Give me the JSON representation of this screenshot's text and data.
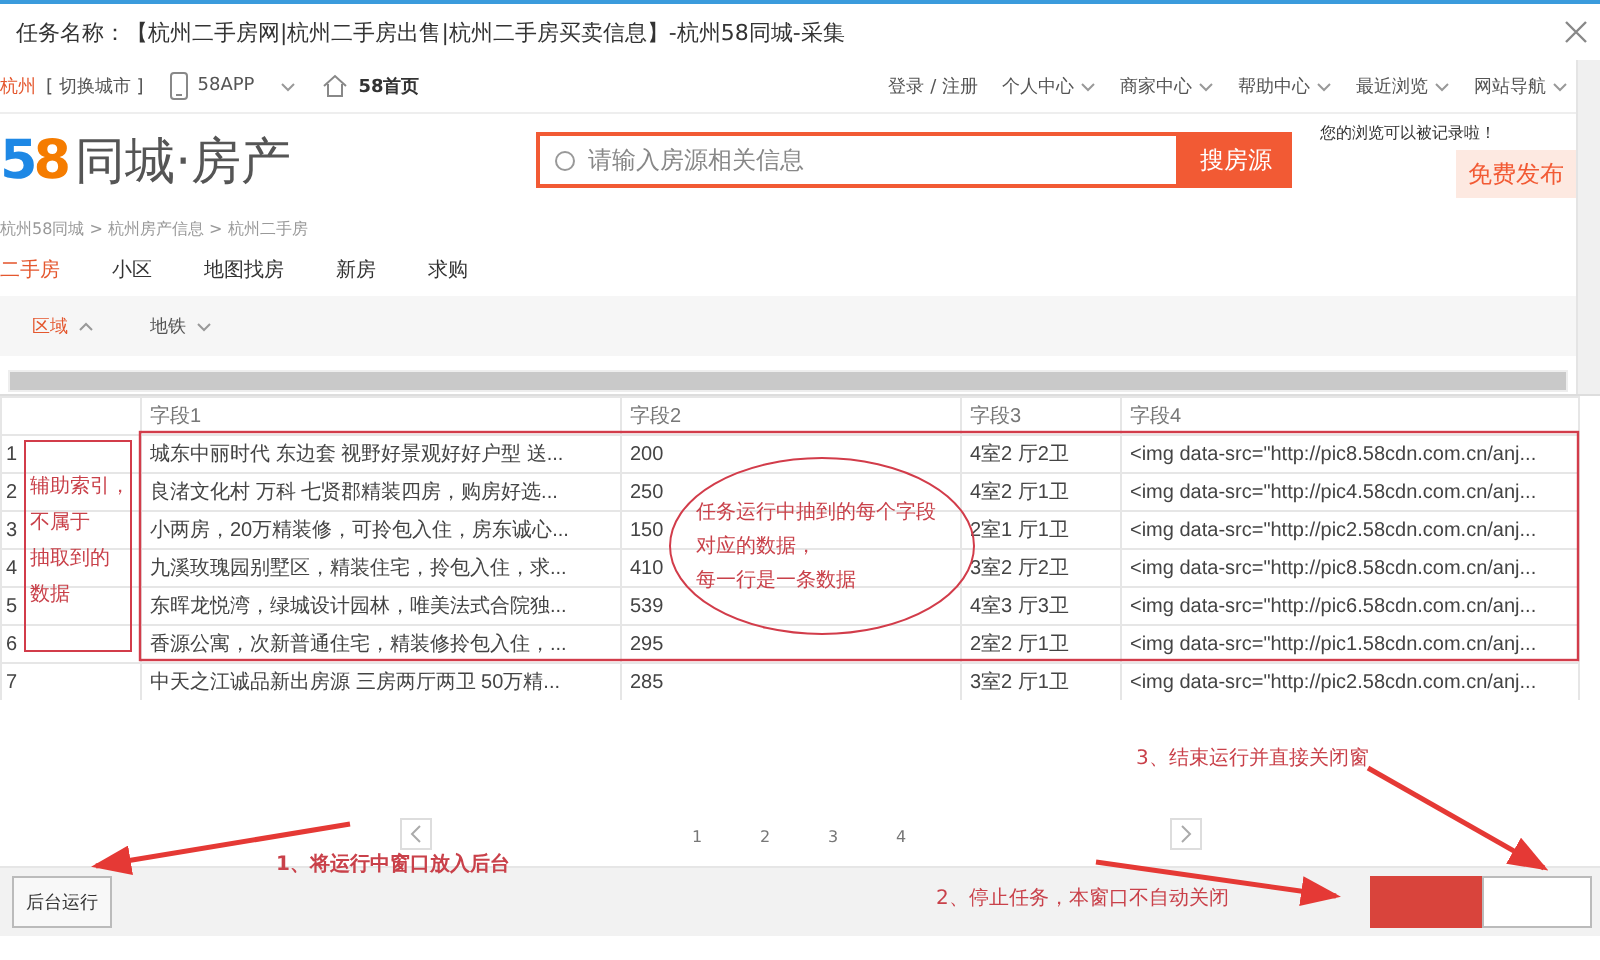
{
  "window": {
    "title": "任务名称：【杭州二手房网|杭州二手房出售|杭州二手房买卖信息】-杭州58同城-采集"
  },
  "site": {
    "city": "杭州",
    "switch_city": "[ 切换城市 ]",
    "app": "58APP",
    "home": "58首页",
    "links": [
      {
        "label": "登录 / 注册",
        "dropdown": false
      },
      {
        "label": "个人中心",
        "dropdown": true
      },
      {
        "label": "商家中心",
        "dropdown": true
      },
      {
        "label": "帮助中心",
        "dropdown": true
      },
      {
        "label": "最近浏览",
        "dropdown": true
      },
      {
        "label": "网站导航",
        "dropdown": true
      }
    ],
    "logo": {
      "number": "58",
      "name": "同城·房产"
    },
    "search": {
      "placeholder": "请输入房源相关信息",
      "button": "搜房源"
    },
    "notice": "您的浏览可以被记录啦！",
    "publish": "免费发布",
    "breadcrumb": "杭州58同城 > 杭州房产信息 > 杭州二手房",
    "tabs": [
      {
        "label": "二手房",
        "selected": true
      },
      {
        "label": "小区",
        "selected": false
      },
      {
        "label": "地图找房",
        "selected": false
      },
      {
        "label": "新房",
        "selected": false
      },
      {
        "label": "求购",
        "selected": false
      }
    ],
    "filters": [
      {
        "label": "区域",
        "selected": true,
        "expanded": true
      },
      {
        "label": "地铁",
        "selected": false,
        "expanded": false
      }
    ]
  },
  "table": {
    "columns": [
      "字段1",
      "字段2",
      "字段3",
      "字段4"
    ],
    "rows": [
      {
        "index": "1",
        "cells": [
          "城东中丽时代 东边套 视野好景观好好户型 送...",
          "200",
          "4室2 厅2卫",
          "<img data-src=\"http://pic8.58cdn.com.cn/anj..."
        ]
      },
      {
        "index": "2",
        "cells": [
          "良渚文化村 万科 七贤郡精装四房，购房好选...",
          "250",
          "4室2 厅1卫",
          "<img data-src=\"http://pic4.58cdn.com.cn/anj..."
        ]
      },
      {
        "index": "3",
        "cells": [
          "小两房，20万精装修，可拎包入住，房东诚心...",
          "150",
          "2室1 厅1卫",
          "<img data-src=\"http://pic2.58cdn.com.cn/anj..."
        ]
      },
      {
        "index": "4",
        "cells": [
          "九溪玫瑰园别墅区，精装住宅，拎包入住，求...",
          "410",
          "3室2 厅2卫",
          "<img data-src=\"http://pic8.58cdn.com.cn/anj..."
        ]
      },
      {
        "index": "5",
        "cells": [
          "东晖龙悦湾，绿城设计园林，唯美法式合院独...",
          "539",
          "4室3 厅3卫",
          "<img data-src=\"http://pic6.58cdn.com.cn/anj..."
        ]
      },
      {
        "index": "6",
        "cells": [
          "香源公寓，次新普通住宅，精装修拎包入住，...",
          "295",
          "2室2 厅1卫",
          "<img data-src=\"http://pic1.58cdn.com.cn/anj..."
        ]
      },
      {
        "index": "7",
        "cells": [
          "中天之江诚品新出房源 三房两厅两卫 50万精...",
          "285",
          "3室2 厅1卫",
          "<img data-src=\"http://pic2.58cdn.com.cn/anj..."
        ]
      }
    ]
  },
  "pagination": {
    "pages": [
      "1",
      "2",
      "3",
      "4"
    ]
  },
  "footer": {
    "buttons": [
      {
        "kind": "background",
        "label": "后台运行"
      },
      {
        "kind": "stop"
      },
      {
        "kind": "close"
      }
    ]
  },
  "annotations": {
    "index_note": [
      "辅助索引，",
      "不属于",
      "抽取到的",
      "数据"
    ],
    "data_note": [
      "任务运行中抽到的每个字段",
      "对应的数据，",
      "每一行是一条数据"
    ],
    "steps": [
      {
        "kind": "background",
        "text": "1、将运行中窗口放入后台"
      },
      {
        "kind": "stop",
        "text": "2、停止任务，本窗口不自动关闭"
      },
      {
        "kind": "close",
        "text": "3、结束运行并直接关闭窗"
      }
    ]
  }
}
